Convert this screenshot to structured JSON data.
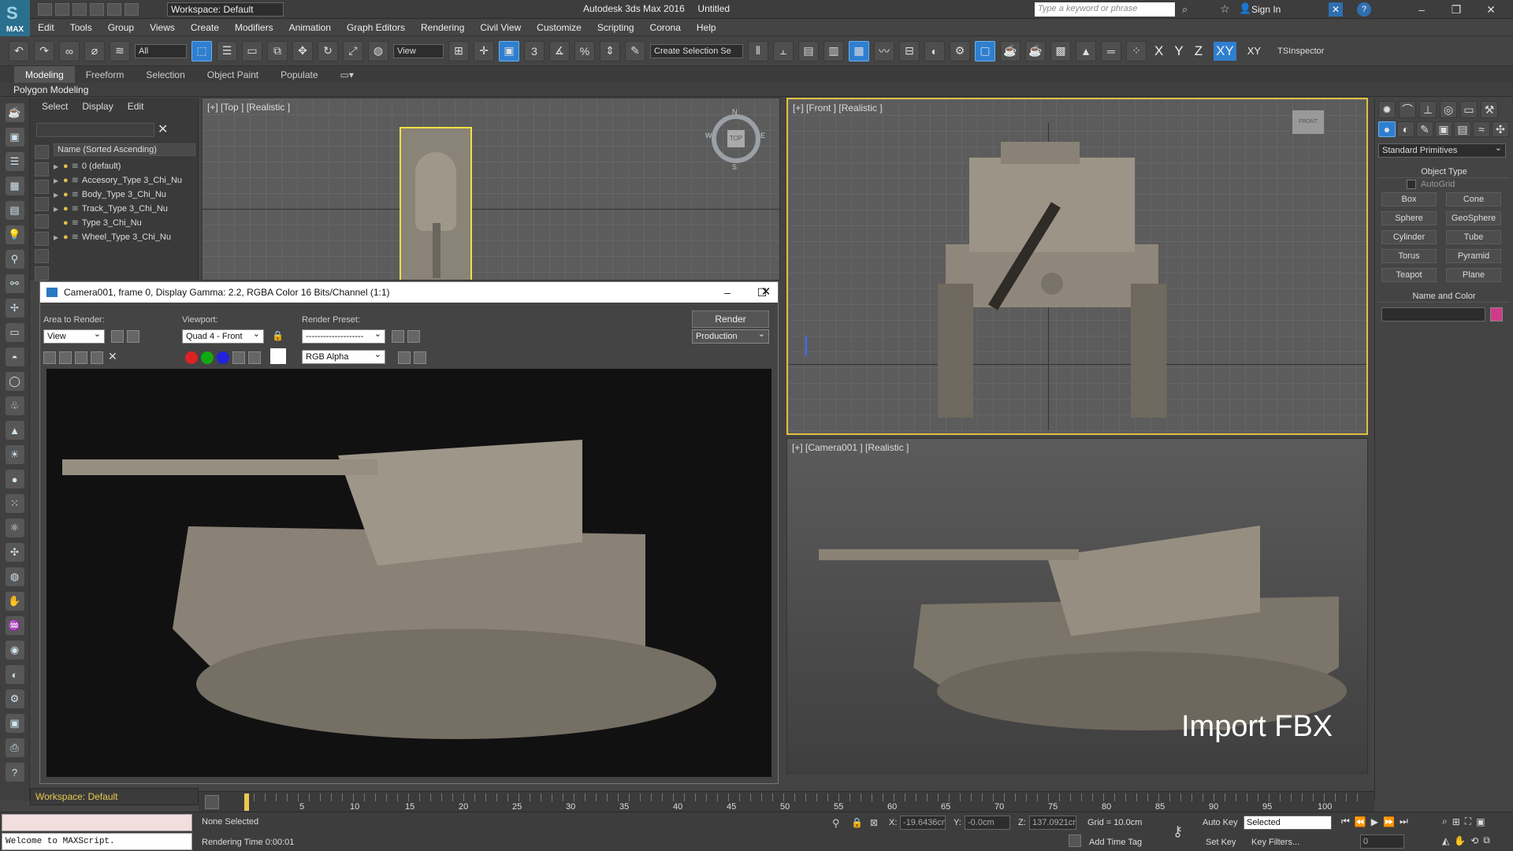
{
  "app": {
    "title": "Autodesk 3ds Max 2016",
    "document": "Untitled",
    "logo": "MAX"
  },
  "workspace": "Workspace: Default",
  "search": {
    "placeholder": "Type a keyword or phrase"
  },
  "sign_in": "Sign In",
  "menu": [
    "Edit",
    "Tools",
    "Group",
    "Views",
    "Create",
    "Modifiers",
    "Animation",
    "Graph Editors",
    "Rendering",
    "Civil View",
    "Customize",
    "Scripting",
    "Corona",
    "Help"
  ],
  "toolbar": {
    "filter": "All",
    "ref_coord": "View",
    "selection_set": "Create Selection Se",
    "axes": [
      "X",
      "Y",
      "Z",
      "XY",
      "XY"
    ],
    "plugin": "TSInspector",
    "snap_labels": [
      "3",
      "%"
    ]
  },
  "ribbon": {
    "tabs": [
      "Modeling",
      "Freeform",
      "Selection",
      "Object Paint",
      "Populate"
    ],
    "active": "Modeling",
    "panel": "Polygon Modeling"
  },
  "explorer": {
    "menu": [
      "Select",
      "Display",
      "Edit"
    ],
    "column": "Name (Sorted Ascending)",
    "items": [
      "0 (default)",
      "Accesory_Type 3_Chi_Nu",
      "Body_Type 3_Chi_Nu",
      "Track_Type 3_Chi_Nu",
      "Type 3_Chi_Nu",
      "Wheel_Type 3_Chi_Nu"
    ]
  },
  "viewports": {
    "top": "[+] [Top ] [Realistic ]",
    "front": "[+] [Front ] [Realistic ]",
    "camera": "[+] [Camera001 ] [Realistic ]",
    "overlay": "Import FBX",
    "viewcube": {
      "n": "N",
      "e": "E",
      "s": "S",
      "w": "W",
      "face": "TOP",
      "front_face": "FRONT"
    }
  },
  "render_window": {
    "title": "Camera001, frame 0, Display Gamma: 2.2, RGBA Color 16 Bits/Channel (1:1)",
    "area_label": "Area to Render:",
    "area_value": "View",
    "viewport_label": "Viewport:",
    "viewport_value": "Quad 4 - Front",
    "preset_label": "Render Preset:",
    "preset_value": "--------------------",
    "render_button": "Render",
    "production": "Production",
    "channel": "RGB Alpha"
  },
  "command_panel": {
    "dropdown": "Standard Primitives",
    "object_type": "Object Type",
    "autogrid": "AutoGrid",
    "buttons": [
      "Box",
      "Cone",
      "Sphere",
      "GeoSphere",
      "Cylinder",
      "Tube",
      "Torus",
      "Pyramid",
      "Teapot",
      "Plane"
    ],
    "name_and_color": "Name and Color",
    "color": "#d03a8a"
  },
  "timeline": {
    "ticks": [
      "5",
      "10",
      "15",
      "20",
      "25",
      "30",
      "35",
      "40",
      "45",
      "50",
      "55",
      "60",
      "65",
      "70",
      "75",
      "80",
      "85",
      "90",
      "95",
      "100"
    ],
    "counter": "0 / 100"
  },
  "status": {
    "workspace": "Workspace: Default",
    "maxscript": "Welcome to MAXScript.",
    "selection": "None Selected",
    "rendering_time": "Rendering Time  0:00:01",
    "x": "-19.6436cm",
    "y": "-0.0cm",
    "z": "137.0921cm",
    "x_label": "X:",
    "y_label": "Y:",
    "z_label": "Z:",
    "grid": "Grid = 10.0cm",
    "add_time_tag": "Add Time Tag",
    "auto_key": "Auto Key",
    "set_key": "Set Key",
    "key_mode": "Selected",
    "key_filters": "Key Filters...",
    "frame": "0"
  },
  "colors": {
    "accent": "#2f7fd0",
    "viewport_border": "#e0c040",
    "selection": "#f0e040"
  }
}
